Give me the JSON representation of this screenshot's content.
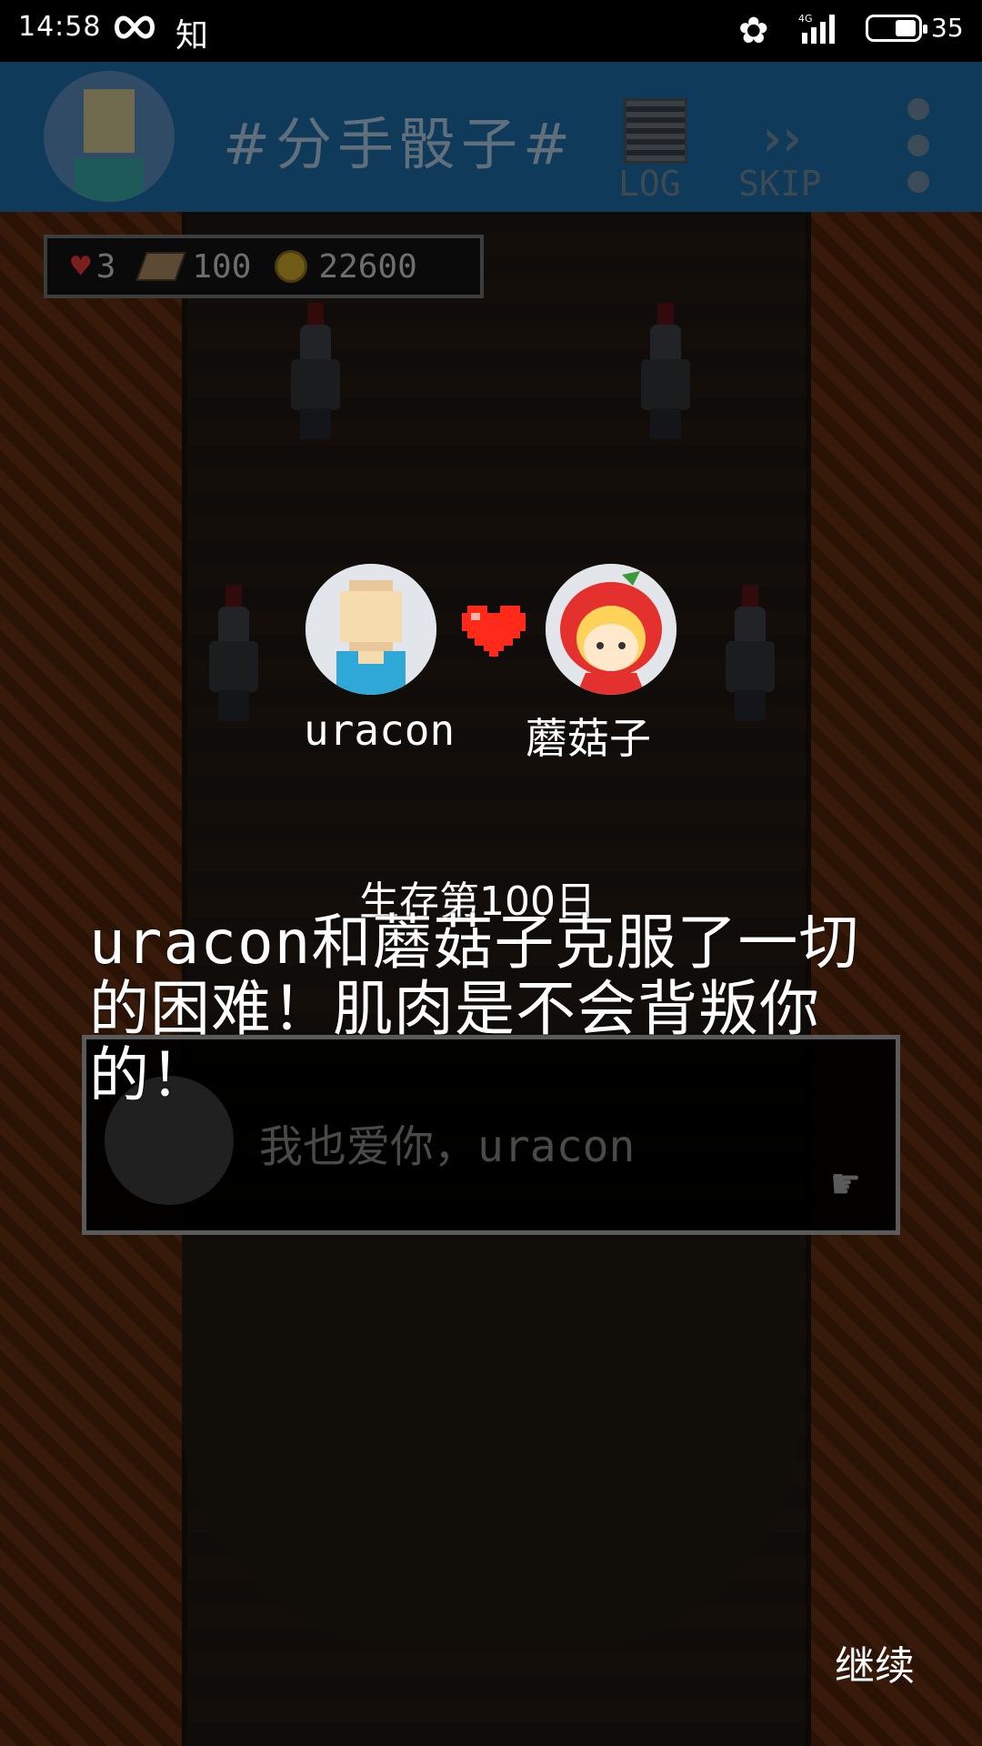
{
  "status_bar": {
    "time": "14:58",
    "app_glyph": "知",
    "network": "4G",
    "battery_level": "35"
  },
  "header": {
    "title": "#分手骰子#",
    "log_label": "LOG",
    "skip_label": "SKIP"
  },
  "stats": {
    "lives": "3",
    "books": "100",
    "coins": "22600"
  },
  "couple": {
    "left_name": "uracon",
    "right_name": "蘑菇子"
  },
  "story": {
    "title": "生存第100日",
    "text": "uracon和蘑菇子克服了一切的困难！肌肉是不会背叛你的！"
  },
  "dialog": {
    "text": "我也爱你，uracon"
  },
  "actions": {
    "continue_label": "继续"
  },
  "colors": {
    "topbar_bg": "#0f3a5a",
    "heart_red": "#ff2a1a",
    "lava": "#7a3a14"
  }
}
